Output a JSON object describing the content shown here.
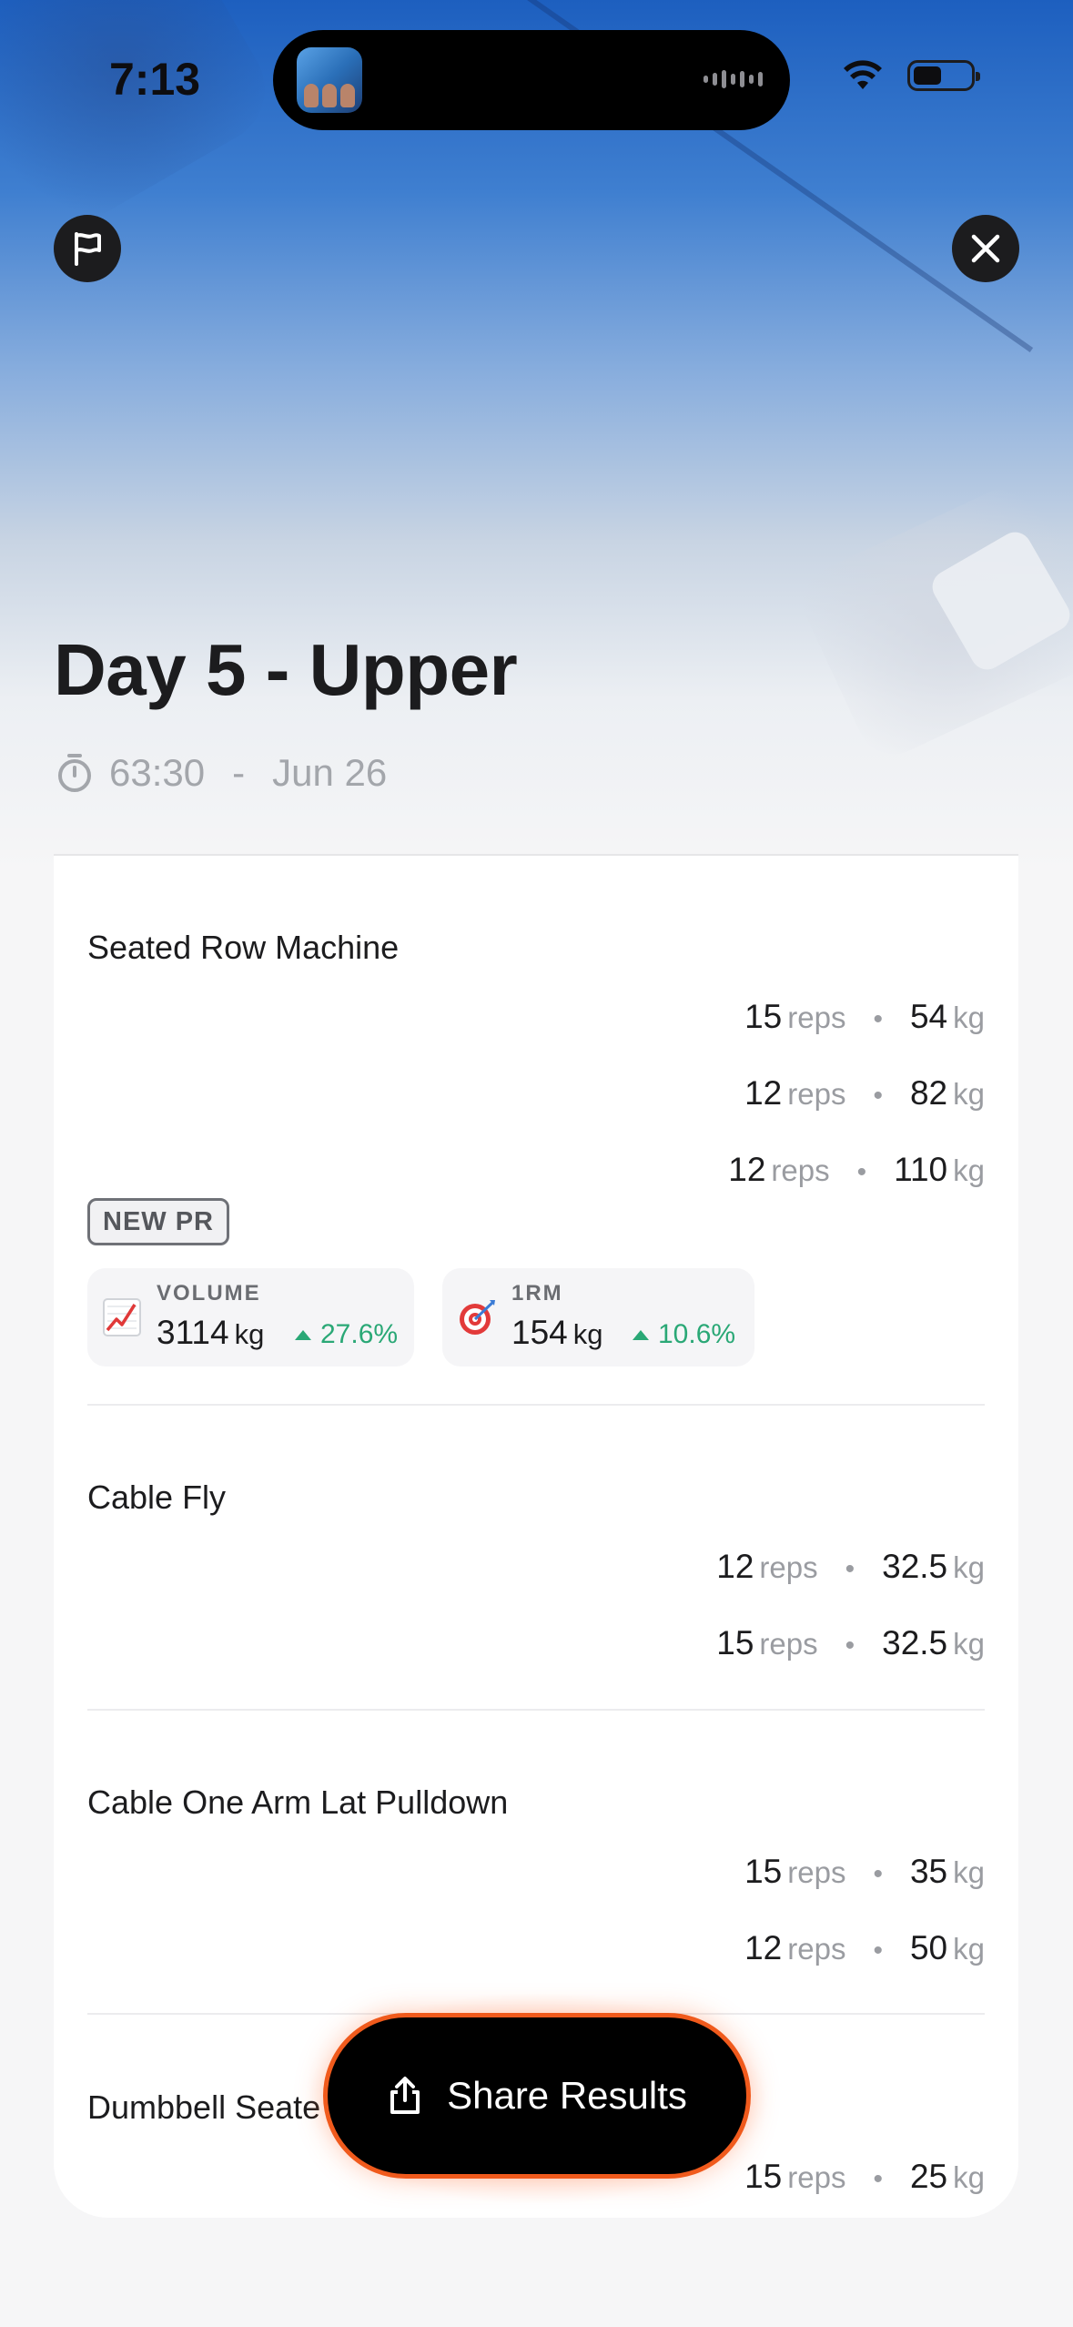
{
  "status_bar": {
    "time": "7:13"
  },
  "workout": {
    "title": "Day 5 - Upper",
    "duration": "63:30",
    "separator": "-",
    "date": "Jun 26"
  },
  "units": {
    "reps": "reps",
    "kg": "kg",
    "dot": "•"
  },
  "exercises": [
    {
      "name": "Seated Row Machine",
      "sets": [
        {
          "reps": "15",
          "weight": "54"
        },
        {
          "reps": "12",
          "weight": "82"
        },
        {
          "reps": "12",
          "weight": "110"
        }
      ],
      "badge": "NEW PR",
      "stats": [
        {
          "label": "VOLUME",
          "value": "3114",
          "unit": "kg",
          "change": "27.6%",
          "icon": "chart-increasing-icon"
        },
        {
          "label": "1RM",
          "value": "154",
          "unit": "kg",
          "change": "10.6%",
          "icon": "target-icon"
        }
      ]
    },
    {
      "name": "Cable Fly",
      "sets": [
        {
          "reps": "12",
          "weight": "32.5"
        },
        {
          "reps": "15",
          "weight": "32.5"
        }
      ]
    },
    {
      "name": "Cable One Arm Lat Pulldown",
      "sets": [
        {
          "reps": "15",
          "weight": "35"
        },
        {
          "reps": "12",
          "weight": "50"
        }
      ]
    },
    {
      "name": "Dumbbell Seate",
      "sets": [
        {
          "reps": "15",
          "weight": "25"
        }
      ]
    }
  ],
  "share_button": {
    "label": "Share Results",
    "icon": "share-icon"
  },
  "colors": {
    "accent": "#f05a1c",
    "positive": "#2aa876",
    "hero_top": "#1d5fbf"
  }
}
